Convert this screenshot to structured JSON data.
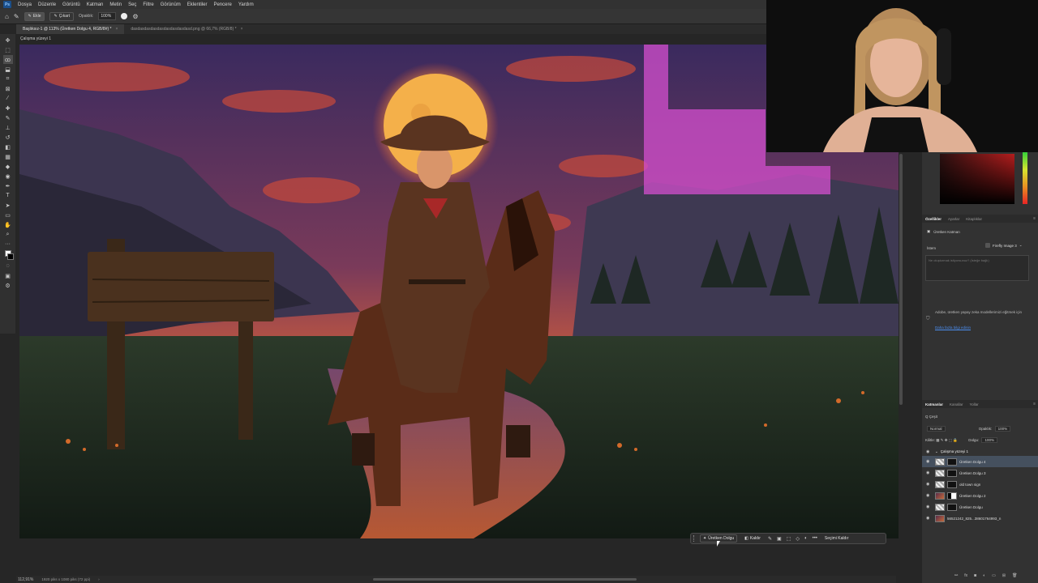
{
  "menu": {
    "logo": "Ps",
    "items": [
      "Dosya",
      "Düzenle",
      "Görüntü",
      "Katman",
      "Metin",
      "Seç",
      "Filtre",
      "Görünüm",
      "Eklentiler",
      "Pencere",
      "Yardım"
    ]
  },
  "options_bar": {
    "add_label": "Ekle",
    "subtract_label": "Çıkart",
    "opacity_label": "Opaklık:",
    "opacity_value": "100%"
  },
  "tabs": [
    {
      "label": "Başlıksız-1 @ 113% (Üretken Dolgu 4, RGB/8#) *",
      "close": "×"
    },
    {
      "label": "dasdasdasdasdasdasdasdasdasd.png @ 66,7% (RGB/8) *",
      "close": "×"
    }
  ],
  "artboard_label": "Çalışma yüzeyi 1",
  "status": {
    "zoom": "112,91%",
    "info": "1920 piks x 1080 piks (72 ppi)",
    "arrow": "›"
  },
  "taskbar": {
    "generative_fill": "Üretken Dolgu",
    "remove": "Kaldır",
    "more": "•••",
    "deselect": "Seçimi Kaldır"
  },
  "properties": {
    "tabs": [
      "Özellikler",
      "Ayarlar",
      "Kitaplıklar"
    ],
    "layer_type": "Üretken Katman",
    "prompt_label": "İstem",
    "model": "Firefly Image 3",
    "prompt_placeholder": "Ne oluşturmak istiyorsunuz? (İsteğe bağlı)",
    "note": "Adobe, üretken yapay zeka modellerimizi eğitmek için",
    "note_link": "Daha fazla bilgi edinin"
  },
  "layers_panel": {
    "tabs": [
      "Katmanlar",
      "Kanallar",
      "Yollar"
    ],
    "filter_label": "Q Çeşit",
    "blend_mode": "Normal",
    "opacity_label": "Opaklık:",
    "opacity_value": "100%",
    "lock_label": "Kilitle:",
    "fill_label": "Dolgu:",
    "fill_value": "100%",
    "group": "Çalışma yüzeyi 1",
    "layers": [
      {
        "name": "Üretken Dolgu 4",
        "selected": true
      },
      {
        "name": "Üretken Dolgu 3",
        "selected": false
      },
      {
        "name": "old town sign",
        "selected": false
      },
      {
        "name": "Üretken Dolgu 2",
        "selected": false
      },
      {
        "name": "Üretken Dolgu",
        "selected": false
      },
      {
        "name": "56521242_825...38601764993_n",
        "selected": false
      }
    ]
  },
  "colors": {
    "accent": "#4b8ef0",
    "selection_magenta": "#d44fcf",
    "moon": "#f4b04a"
  }
}
